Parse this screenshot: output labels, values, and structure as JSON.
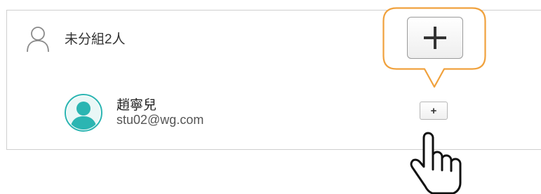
{
  "group": {
    "label": "未分組2人",
    "icon": "person-outline-icon"
  },
  "member": {
    "name": "趙寧兒",
    "email": "stu02@wg.com",
    "avatar_icon": "user-avatar-icon",
    "avatar_color": "#2bb5b2"
  },
  "add_button": {
    "icon": "plus-icon"
  },
  "callout": {
    "border_color": "#f0a13c",
    "icon": "plus-icon"
  },
  "cursor": {
    "icon": "pointing-hand-cursor-icon"
  }
}
